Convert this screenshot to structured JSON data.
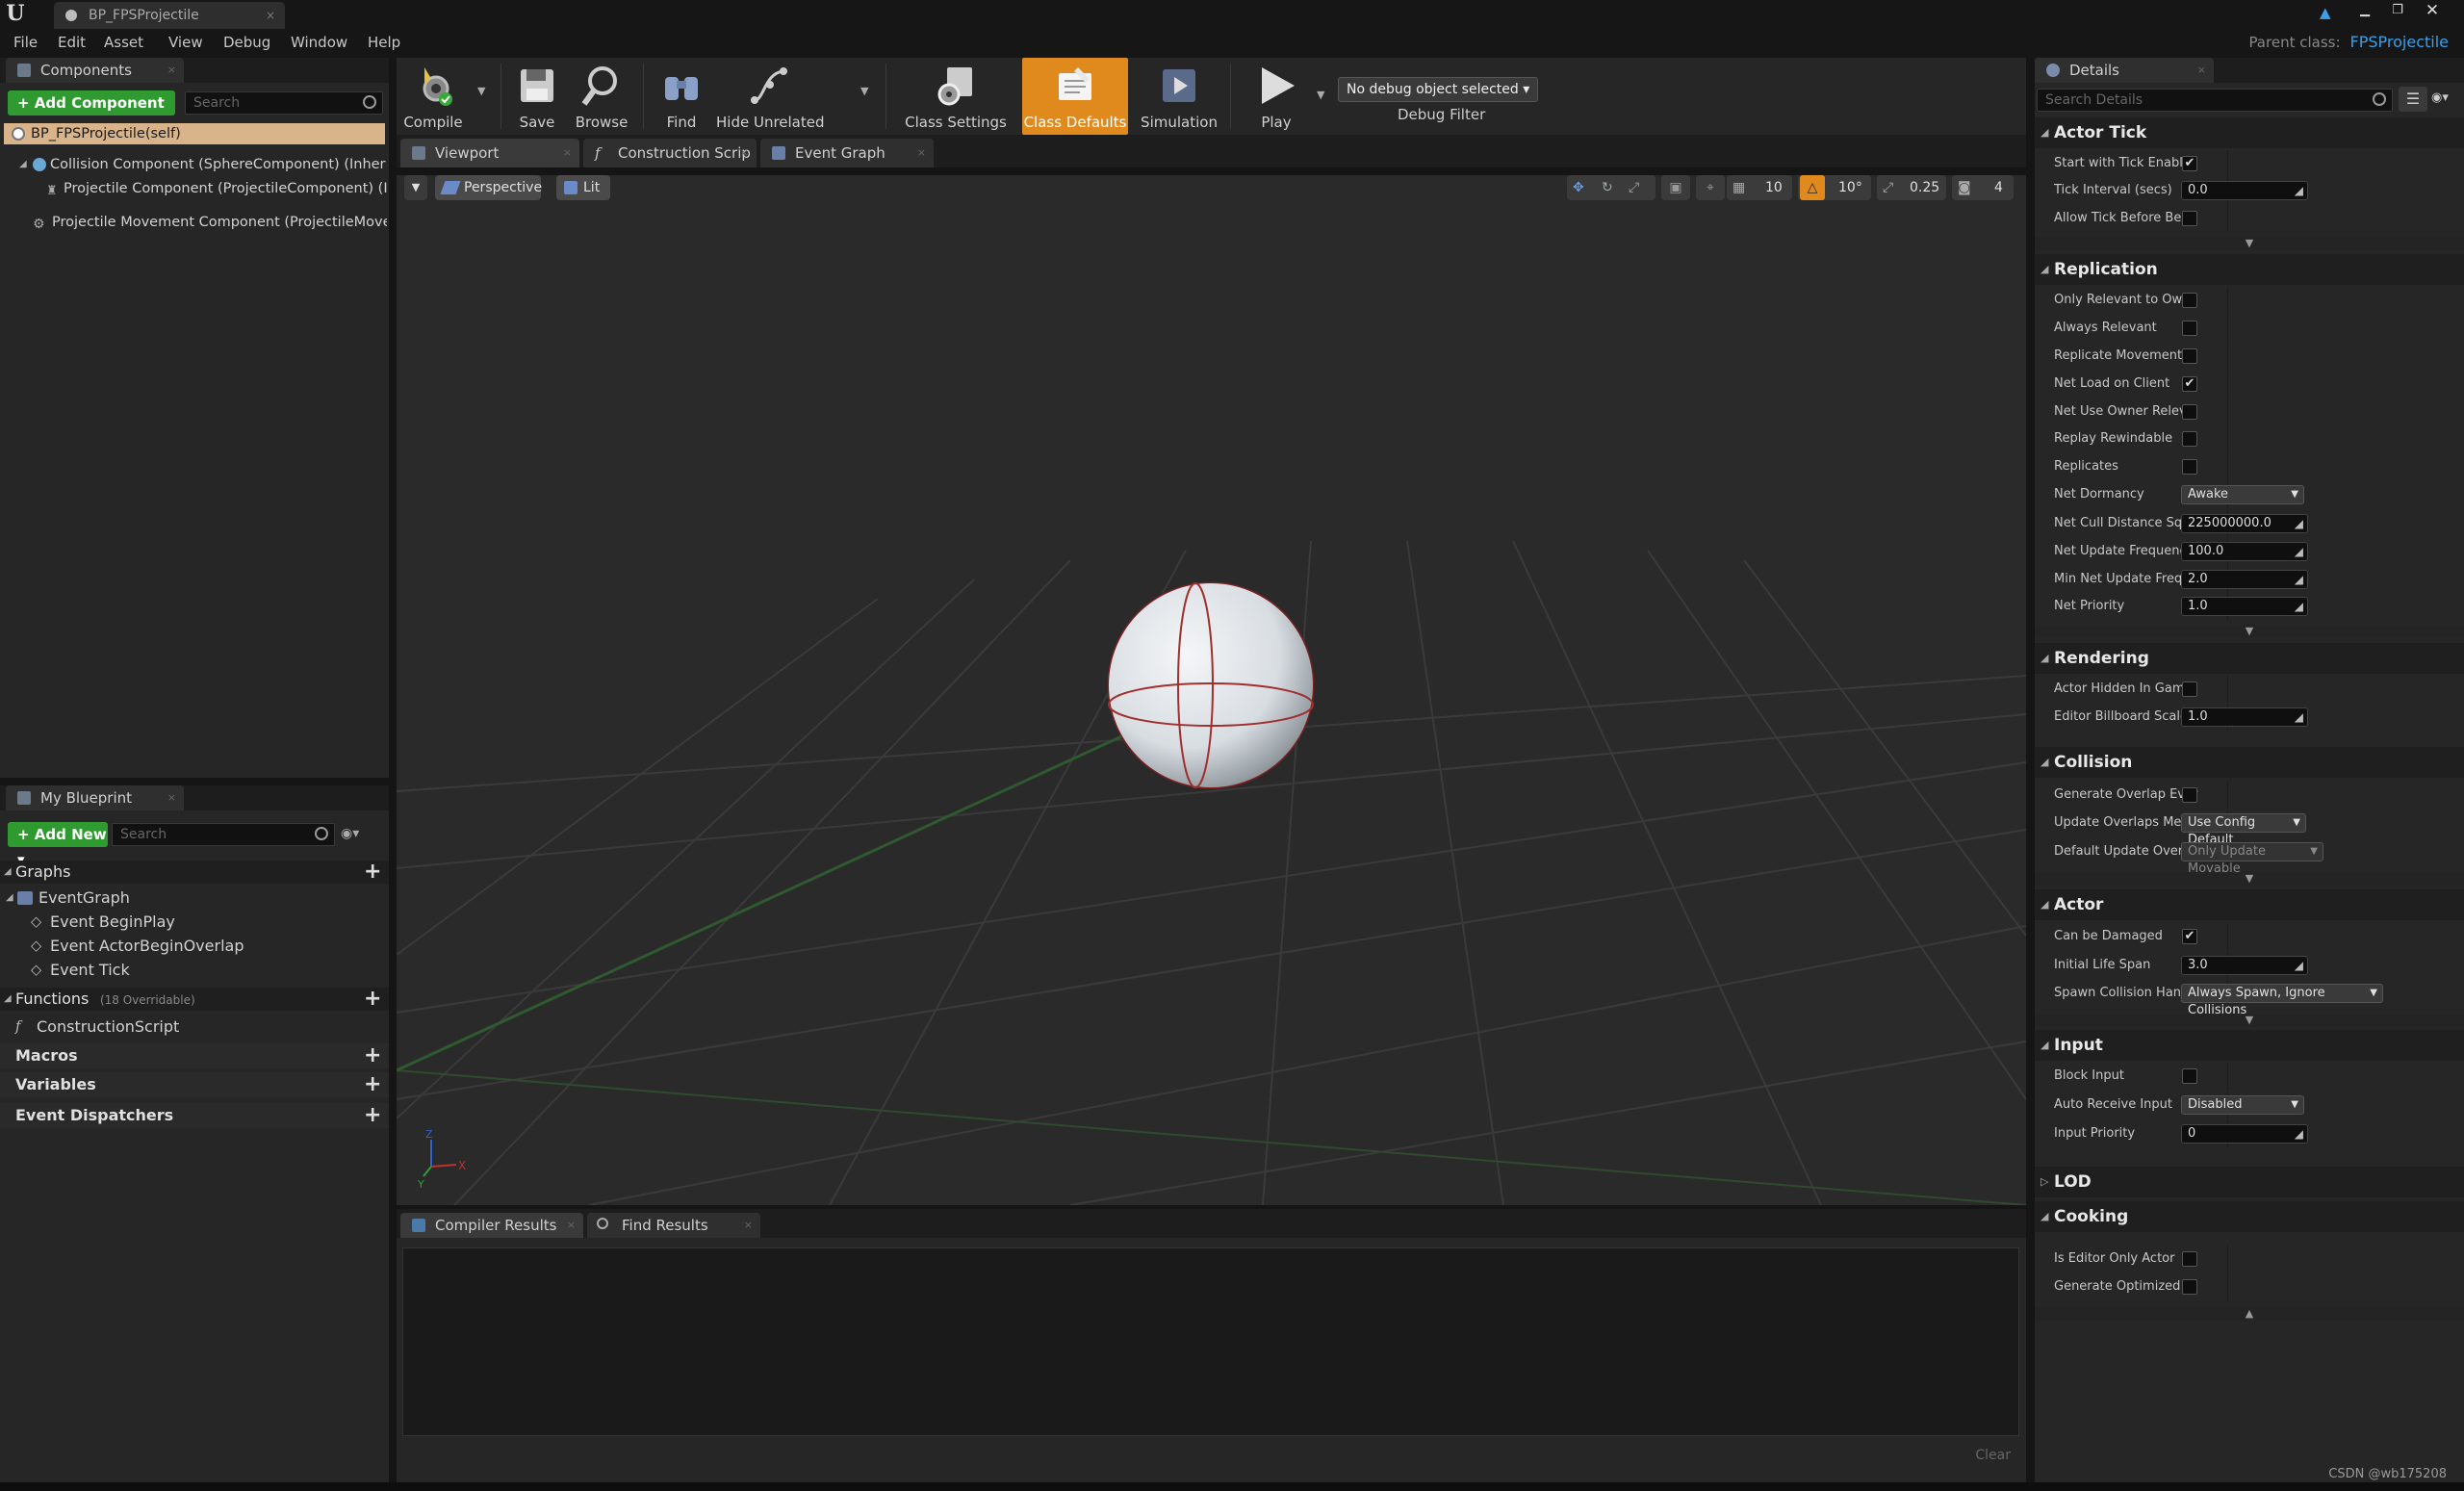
{
  "window": {
    "doc_tab": "BP_FPSProjectile",
    "parent_class_label": "Parent class:",
    "parent_class_value": "FPSProjectile"
  },
  "menu": [
    "File",
    "Edit",
    "Asset",
    "View",
    "Debug",
    "Window",
    "Help"
  ],
  "components": {
    "tab": "Components",
    "add_button": "+ Add Component ▾",
    "search_placeholder": "Search",
    "self": "BP_FPSProjectile(self)",
    "items": [
      "Collision Component (SphereComponent) (Inher",
      "Projectile Component (ProjectileComponent) (In",
      "Projectile Movement Component (ProjectileMover"
    ]
  },
  "toolbar": {
    "compile": "Compile",
    "save": "Save",
    "browse": "Browse",
    "find": "Find",
    "hide_unrelated": "Hide Unrelated",
    "class_settings": "Class Settings",
    "class_defaults": "Class Defaults",
    "simulation": "Simulation",
    "play": "Play",
    "debug_select": "No debug object selected ▾",
    "debug_filter": "Debug Filter"
  },
  "editor_tabs": [
    "Viewport",
    "Construction Scrip",
    "Event Graph"
  ],
  "viewport": {
    "perspective": "Perspective",
    "lit": "Lit",
    "grid_snap": "10",
    "rot_snap": "10°",
    "scale_snap": "0.25",
    "cam_speed": "4",
    "axis_z": "Z",
    "axis_x": "X",
    "axis_y": "Y"
  },
  "my_blueprint": {
    "tab": "My Blueprint",
    "add_button": "+ Add New ▾",
    "search_placeholder": "Search",
    "graphs_label": "Graphs",
    "event_graph": "EventGraph",
    "events": [
      "Event BeginPlay",
      "Event ActorBeginOverlap",
      "Event Tick"
    ],
    "functions_label": "Functions",
    "functions_count": "(18 Overridable)",
    "construction_script": "ConstructionScript",
    "macros": "Macros",
    "variables": "Variables",
    "dispatchers": "Event Dispatchers"
  },
  "bottom": {
    "tab_compiler": "Compiler Results",
    "tab_find": "Find Results",
    "clear": "Clear"
  },
  "details": {
    "tab": "Details",
    "search_placeholder": "Search Details",
    "actor_tick": "Actor Tick",
    "start_tick": "Start with Tick Enablec",
    "tick_interval": "Tick Interval (secs)",
    "tick_interval_val": "0.0",
    "allow_tick": "Allow Tick Before Begi",
    "replication": "Replication",
    "only_relevant": "Only Relevant to Owne",
    "always_relevant": "Always Relevant",
    "replicate_movement": "Replicate Movement",
    "net_load": "Net Load on Client",
    "net_use_owner": "Net Use Owner Releva",
    "replay_rewindable": "Replay Rewindable",
    "replicates": "Replicates",
    "net_dormancy": "Net Dormancy",
    "net_dormancy_val": "Awake",
    "net_cull": "Net Cull Distance Squ",
    "net_cull_val": "225000000.0",
    "net_update": "Net Update Frequency",
    "net_update_val": "100.0",
    "min_net_update": "Min Net Update Freque",
    "min_net_update_val": "2.0",
    "net_priority": "Net Priority",
    "net_priority_val": "1.0",
    "rendering": "Rendering",
    "actor_hidden": "Actor Hidden In Game",
    "billboard": "Editor Billboard Scale",
    "billboard_val": "1.0",
    "collision": "Collision",
    "gen_overlap": "Generate Overlap Ever",
    "update_overlaps": "Update Overlaps Meth",
    "update_overlaps_val": "Use Config Default",
    "default_update": "Default Update Overla",
    "default_update_val": "Only Update Movable",
    "actor": "Actor",
    "can_be_damaged": "Can be Damaged",
    "initial_life": "Initial Life Span",
    "initial_life_val": "3.0",
    "spawn_collision": "Spawn Collision Handl",
    "spawn_collision_val": "Always Spawn, Ignore Collisions",
    "input": "Input",
    "block_input": "Block Input",
    "auto_receive": "Auto Receive Input",
    "auto_receive_val": "Disabled",
    "input_priority": "Input Priority",
    "input_priority_val": "0",
    "lod": "LOD",
    "cooking": "Cooking",
    "editor_only": "Is Editor Only Actor",
    "gen_optimized": "Generate Optimized Bl"
  },
  "checkbox_states": {
    "start_tick": true,
    "allow_tick": false,
    "only_relevant": false,
    "always_relevant": false,
    "replicate_movement": false,
    "net_load": true,
    "net_use_owner": false,
    "replay_rewindable": false,
    "replicates": false,
    "actor_hidden": false,
    "gen_overlap": false,
    "can_be_damaged": true,
    "block_input": false,
    "editor_only": false,
    "gen_optimized": false
  },
  "watermark": "CSDN @wb175208",
  "colors": {
    "accent_orange": "#e08a1e",
    "green_button": "#2f9a2f",
    "link_blue": "#3aa0e8",
    "selection_tan": "#d9b48a"
  }
}
